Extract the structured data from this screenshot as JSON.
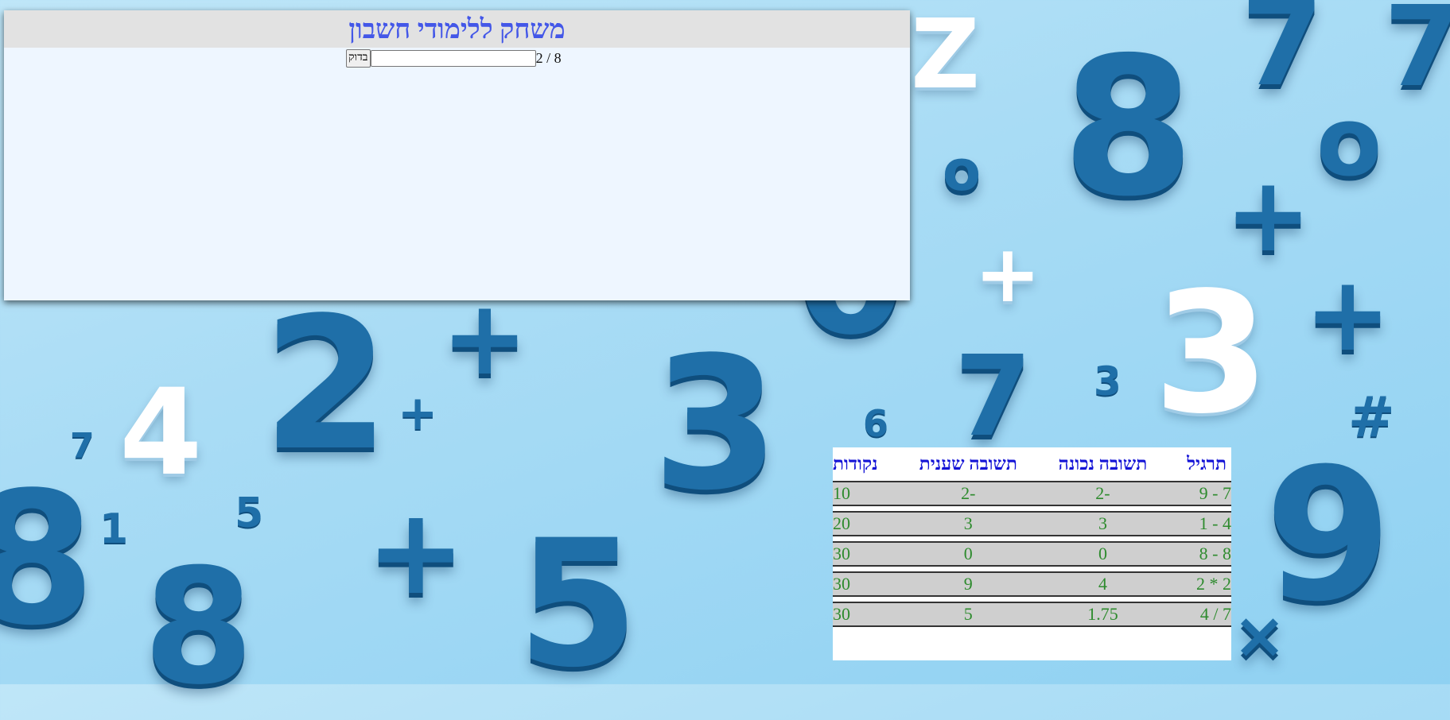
{
  "title": "משחק ללימודי חשבון",
  "exercise": {
    "text": "8 / 2",
    "input_value": "",
    "check_label": "בדוק"
  },
  "results": {
    "headers": {
      "exercise": "תרגיל",
      "correct": "תשובה נכונה",
      "given": "תשובה שענית",
      "points": "נקודות"
    },
    "rows": [
      {
        "exercise": "7 - 9",
        "correct": "-2",
        "given": "-2",
        "points": "10"
      },
      {
        "exercise": "4 - 1",
        "correct": "3",
        "given": "3",
        "points": "20"
      },
      {
        "exercise": "8 - 8",
        "correct": "0",
        "given": "0",
        "points": "30"
      },
      {
        "exercise": "2 * 2",
        "correct": "4",
        "given": "9",
        "points": "30"
      },
      {
        "exercise": "7 / 4",
        "correct": "1.75",
        "given": "5",
        "points": "30"
      }
    ]
  },
  "colors": {
    "title": "#4357e8",
    "header_text": "#1313d6",
    "row_text": "#2e8b2e",
    "row_bg": "#cfcfcf"
  }
}
